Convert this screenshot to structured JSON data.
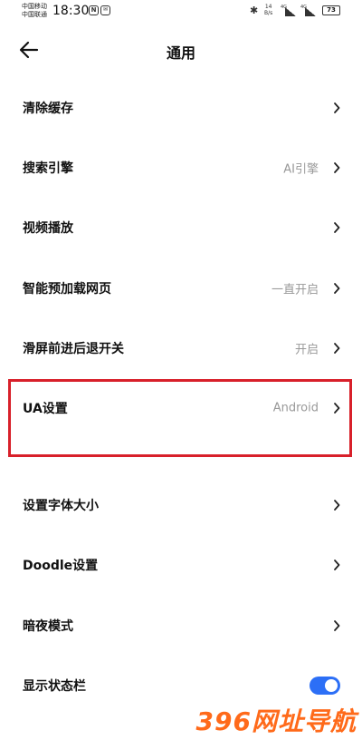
{
  "status_bar": {
    "carrier_1": "中国移动",
    "carrier_2": "中国联通",
    "time": "18:30",
    "notif_1": "N",
    "notif_2": "✉",
    "speed_value": "14",
    "speed_unit": "B/s",
    "signal_1_tag": "4G",
    "signal_2_tag": "4G",
    "battery": "73"
  },
  "header": {
    "back_icon": "back-arrow-icon",
    "title": "通用"
  },
  "settings": [
    {
      "label": "清除缓存",
      "value": ""
    },
    {
      "label": "搜索引擎",
      "value": "AI引擎"
    },
    {
      "label": "视频播放",
      "value": ""
    },
    {
      "label": "智能预加载网页",
      "value": "一直开启"
    },
    {
      "label": "滑屏前进后退开关",
      "value": "开启"
    },
    {
      "label": "UA设置",
      "value": "Android"
    },
    {
      "label": "设置字体大小",
      "value": ""
    },
    {
      "label": "Doodle设置",
      "value": ""
    },
    {
      "label": "暗夜模式",
      "value": ""
    },
    {
      "label": "显示状态栏",
      "toggle": true
    }
  ],
  "colors": {
    "accent": "#2c6ff6",
    "highlight": "#d8202a",
    "secondary_text": "#999999"
  },
  "watermark": "396网址导航"
}
